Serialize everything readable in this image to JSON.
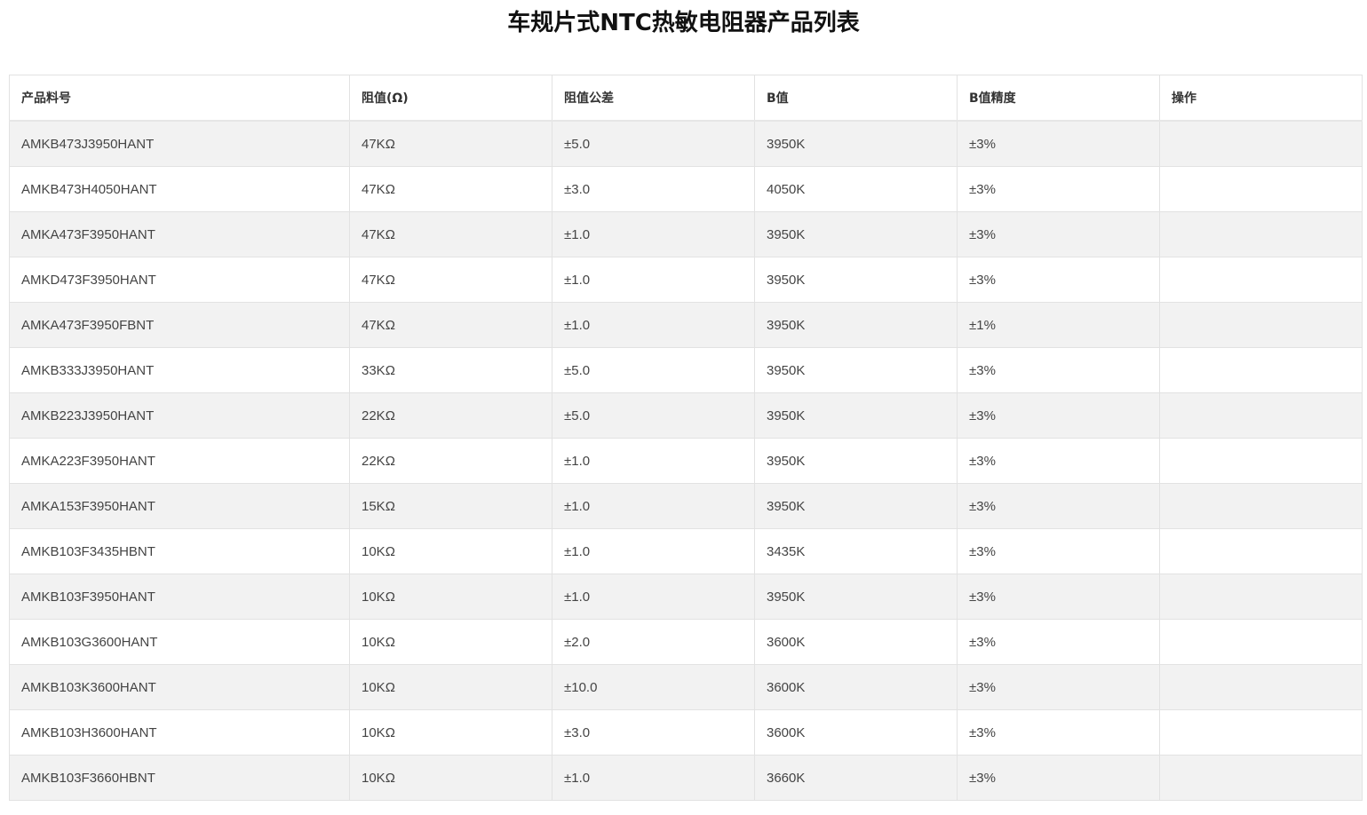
{
  "page": {
    "title": "车规片式NTC热敏电阻器产品列表"
  },
  "table": {
    "headers": [
      "产品料号",
      "阻值(Ω)",
      "阻值公差",
      "B值",
      "B值精度",
      "操作"
    ],
    "rows": [
      [
        "AMKB473J3950HANT",
        "47KΩ",
        "±5.0",
        "3950K",
        "±3%",
        ""
      ],
      [
        "AMKB473H4050HANT",
        "47KΩ",
        "±3.0",
        "4050K",
        "±3%",
        ""
      ],
      [
        "AMKA473F3950HANT",
        "47KΩ",
        "±1.0",
        "3950K",
        "±3%",
        ""
      ],
      [
        "AMKD473F3950HANT",
        "47KΩ",
        "±1.0",
        "3950K",
        "±3%",
        ""
      ],
      [
        "AMKA473F3950FBNT",
        "47KΩ",
        "±1.0",
        "3950K",
        "±1%",
        ""
      ],
      [
        "AMKB333J3950HANT",
        "33KΩ",
        "±5.0",
        "3950K",
        "±3%",
        ""
      ],
      [
        "AMKB223J3950HANT",
        "22KΩ",
        "±5.0",
        "3950K",
        "±3%",
        ""
      ],
      [
        "AMKA223F3950HANT",
        "22KΩ",
        "±1.0",
        "3950K",
        "±3%",
        ""
      ],
      [
        "AMKA153F3950HANT",
        "15KΩ",
        "±1.0",
        "3950K",
        "±3%",
        ""
      ],
      [
        "AMKB103F3435HBNT",
        "10KΩ",
        "±1.0",
        "3435K",
        "±3%",
        ""
      ],
      [
        "AMKB103F3950HANT",
        "10KΩ",
        "±1.0",
        "3950K",
        "±3%",
        ""
      ],
      [
        "AMKB103G3600HANT",
        "10KΩ",
        "±2.0",
        "3600K",
        "±3%",
        ""
      ],
      [
        "AMKB103K3600HANT",
        "10KΩ",
        "±10.0",
        "3600K",
        "±3%",
        ""
      ],
      [
        "AMKB103H3600HANT",
        "10KΩ",
        "±3.0",
        "3600K",
        "±3%",
        ""
      ],
      [
        "AMKB103F3660HBNT",
        "10KΩ",
        "±1.0",
        "3660K",
        "±3%",
        ""
      ]
    ]
  },
  "colors": {
    "stripe": "#f2f2f2",
    "border": "#e2e2e2",
    "text": "#444444",
    "title": "#111111"
  }
}
